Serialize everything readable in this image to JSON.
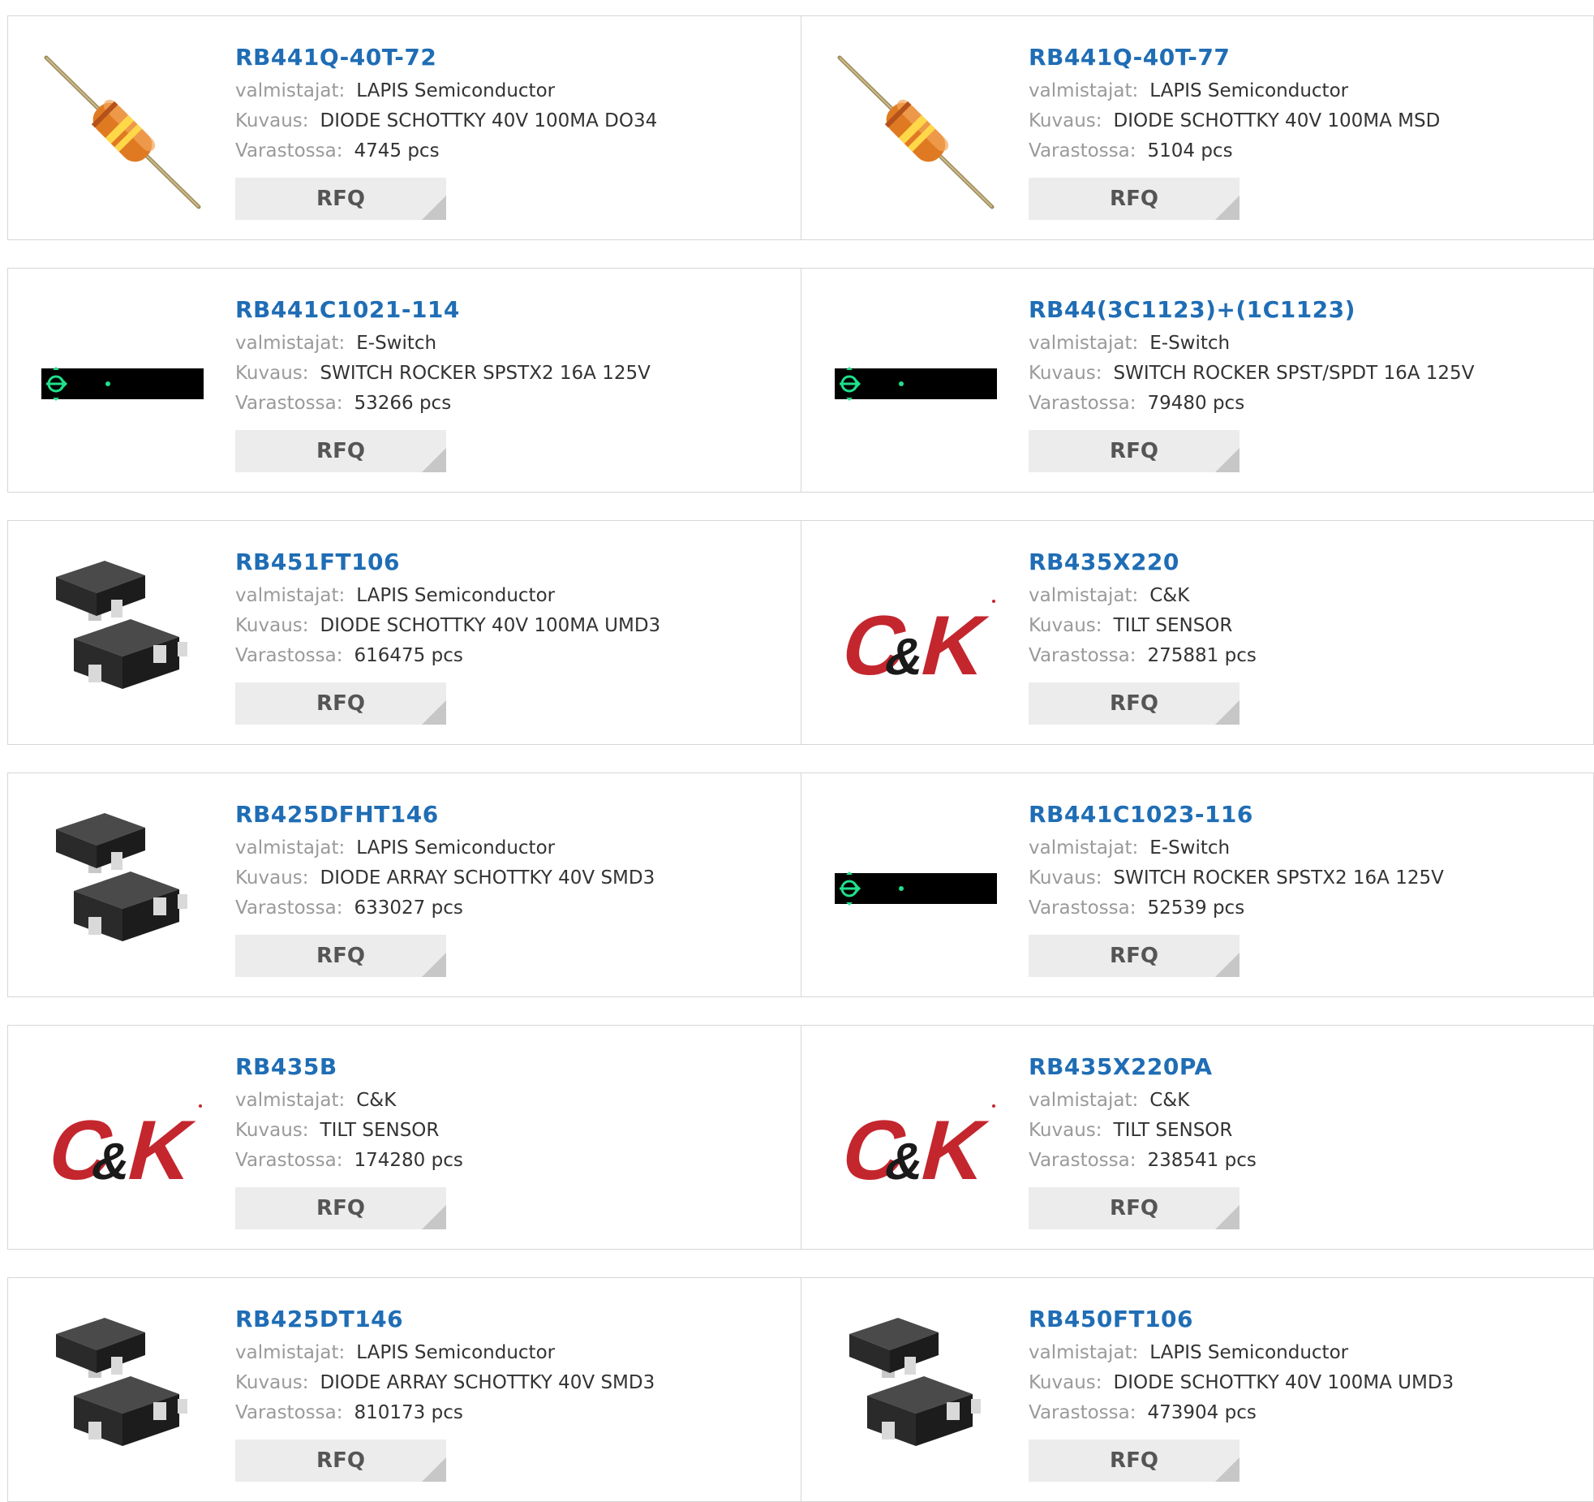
{
  "labels": {
    "manufacturer": "valmistajat:",
    "description": "Kuvaus:",
    "stock": "Varastossa:",
    "rfq": "RFQ"
  },
  "products": [
    {
      "part": "RB441Q-40T-72",
      "manufacturer": "LAPIS Semiconductor",
      "description": "DIODE SCHOTTKY 40V 100MA DO34",
      "stock": "4745 pcs",
      "image": "axial-diode-icon"
    },
    {
      "part": "RB441Q-40T-77",
      "manufacturer": "LAPIS Semiconductor",
      "description": "DIODE SCHOTTKY 40V 100MA MSD",
      "stock": "5104 pcs",
      "image": "axial-diode-icon"
    },
    {
      "part": "RB441C1021-114",
      "manufacturer": "E-Switch",
      "description": "SWITCH ROCKER SPSTX2 16A 125V",
      "stock": "53266 pcs",
      "image": "rocker-switch-icon"
    },
    {
      "part": "RB44(3C1123)+(1C1123)",
      "manufacturer": "E-Switch",
      "description": "SWITCH ROCKER SPST/SPDT 16A 125V",
      "stock": "79480 pcs",
      "image": "rocker-switch-icon"
    },
    {
      "part": "RB451FT106",
      "manufacturer": "LAPIS Semiconductor",
      "description": "DIODE SCHOTTKY 40V 100MA UMD3",
      "stock": "616475 pcs",
      "image": "smd-package-icon"
    },
    {
      "part": "RB435X220",
      "manufacturer": "C&K",
      "description": "TILT SENSOR",
      "stock": "275881 pcs",
      "image": "ck-logo"
    },
    {
      "part": "RB425DFHT146",
      "manufacturer": "LAPIS Semiconductor",
      "description": "DIODE ARRAY SCHOTTKY 40V SMD3",
      "stock": "633027 pcs",
      "image": "smd-package-icon"
    },
    {
      "part": "RB441C1023-116",
      "manufacturer": "E-Switch",
      "description": "SWITCH ROCKER SPSTX2 16A 125V",
      "stock": "52539 pcs",
      "image": "rocker-switch-icon"
    },
    {
      "part": "RB435B",
      "manufacturer": "C&K",
      "description": "TILT SENSOR",
      "stock": "174280 pcs",
      "image": "ck-logo"
    },
    {
      "part": "RB435X220PA",
      "manufacturer": "C&K",
      "description": "TILT SENSOR",
      "stock": "238541 pcs",
      "image": "ck-logo"
    },
    {
      "part": "RB425DT146",
      "manufacturer": "LAPIS Semiconductor",
      "description": "DIODE ARRAY SCHOTTKY 40V SMD3",
      "stock": "810173 pcs",
      "image": "smd-package-icon"
    },
    {
      "part": "RB450FT106",
      "manufacturer": "LAPIS Semiconductor",
      "description": "DIODE SCHOTTKY 40V 100MA UMD3",
      "stock": "473904 pcs",
      "image": "smd-package-icon"
    }
  ],
  "colors": {
    "link": "#1f6db5",
    "label": "#9a9a9a",
    "value": "#333333",
    "rfq_bg": "#ececec",
    "border": "#d6d6d6",
    "brand_red": "#c4262e"
  }
}
